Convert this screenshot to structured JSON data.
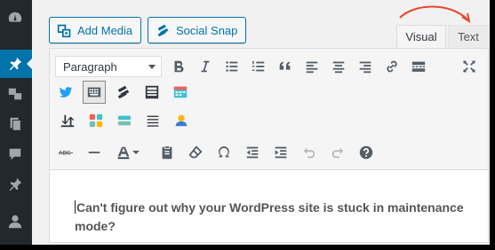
{
  "buttons": {
    "add_media": "Add Media",
    "social_snap": "Social Snap"
  },
  "tabs": {
    "visual": "Visual",
    "text": "Text"
  },
  "toolbar": {
    "format_value": "Paragraph"
  },
  "editor": {
    "content": "Can't figure out why your WordPress site is stuck in maintenance mode?"
  },
  "colors": {
    "accent": "#0073aa",
    "admin_bar": "#23282d",
    "annotation_arrow": "#e8472b"
  }
}
